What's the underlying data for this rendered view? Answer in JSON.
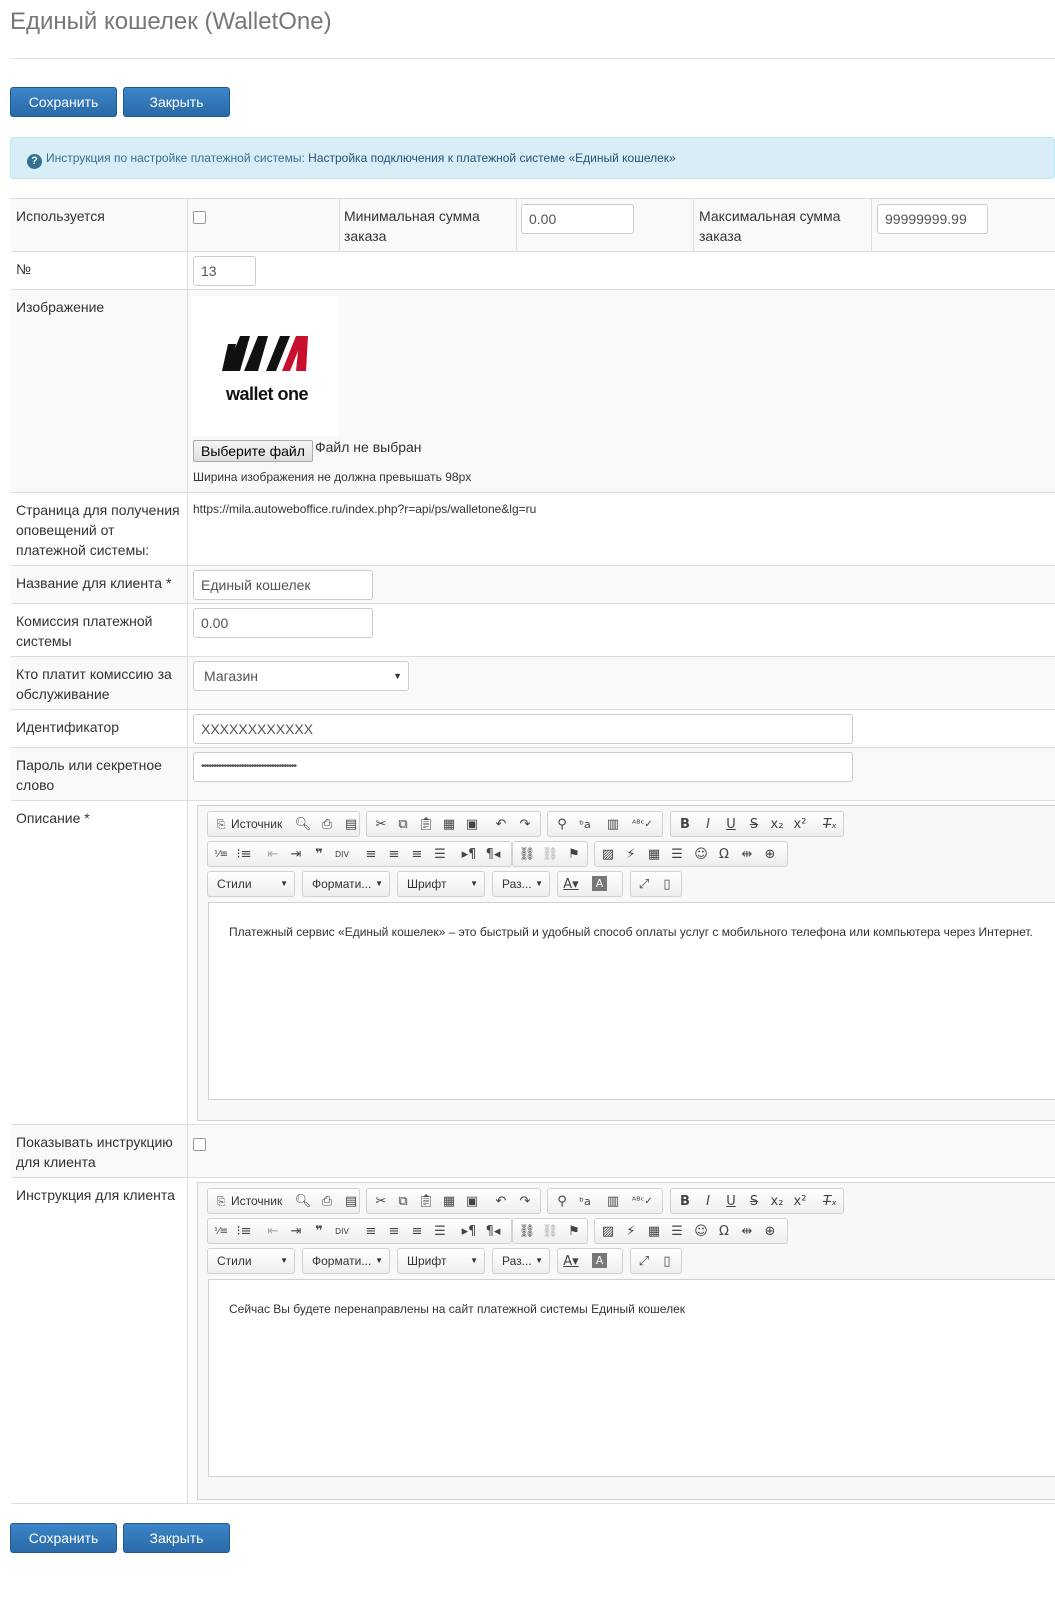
{
  "page": {
    "title": "Единый кошелек (WalletOne)"
  },
  "buttons": {
    "save": "Сохранить",
    "close": "Закрыть"
  },
  "alert": {
    "prefix": "Инструкция по настройке платежной системы:",
    "link": "Настройка подключения к платежной системе «Единый кошелек»"
  },
  "form": {
    "used_label": "Используется",
    "min_label": "Минимальная сумма заказа",
    "min_value": "0.00",
    "max_label": "Максимальная сумма заказа",
    "max_value": "99999999.99",
    "num_label": "№",
    "num_value": "13",
    "image_label": "Изображение",
    "logo_text": "wallet one",
    "file_button": "Выберите файл",
    "file_status": "Файл не выбран",
    "image_hint": "Ширина изображения не должна превышать 98px",
    "notify_label": "Страница для получения оповещений от платежной системы:",
    "notify_url": "https://mila.autoweboffice.ru/index.php?r=api/ps/walletone&lg=ru",
    "client_name_label": "Название для клиента *",
    "client_name_value": "Единый кошелек",
    "commission_label": "Комиссия платежной системы",
    "commission_value": "0.00",
    "payer_label": "Кто платит комиссию за обслуживание",
    "payer_value": "Магазин",
    "ident_label": "Идентификатор",
    "ident_value": "XXXXXXXXXXXX",
    "password_label": "Пароль или секретное слово",
    "password_value": "••••••••••••••••••••••••••••••••••••••",
    "desc_label": "Описание *",
    "desc_text": "Платежный сервис «Единый кошелек» – это быстрый и удобный способ оплаты услуг с мобильного телефона или компьютера через Интернет.",
    "show_instr_label": "Показывать инструкцию для клиента",
    "instr_label": "Инструкция для клиента",
    "instr_text": "Сейчас Вы будете перенаправлены на сайт платежной системы Единый кошелек"
  },
  "editor": {
    "source": "Источник",
    "styles": "Стили",
    "format": "Формати...",
    "font": "Шрифт",
    "size": "Раз..."
  }
}
